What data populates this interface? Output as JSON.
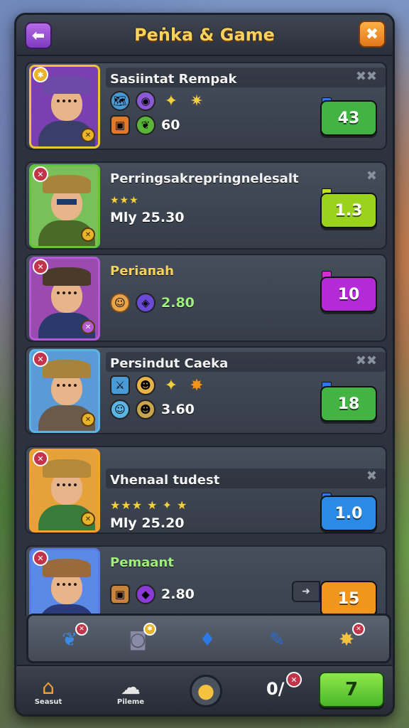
{
  "header": {
    "title": "Peṅka & Game",
    "back_icon": "back-arrow-icon",
    "close_icon": "star-close-icon"
  },
  "players": [
    {
      "name": "Sasiintat Rempak",
      "stat": "60",
      "score": "43",
      "score_color": "#43b344",
      "frame_color": "#f1c232",
      "bg": "#7a3fb0",
      "hat": "#6e4aa8",
      "body": "#3a3f6a"
    },
    {
      "name": "Perringsakrepringnelesalt",
      "stat": "Mly 25.30",
      "score": "1.3",
      "score_color": "#9ad21c",
      "frame_color": "#62c43a",
      "bg": "#7ac05a",
      "hat": "#a8843a",
      "body": "#4a6a2a"
    },
    {
      "name": "Periaпah",
      "stat": "2.80",
      "score": "10",
      "score_color": "#b42ad6",
      "frame_color": "#b45ad6",
      "bg": "#9a4ab0",
      "hat": "#4a3a2a",
      "body": "#2a3a6a"
    },
    {
      "name": "Persindut Caeka",
      "stat": "3.60",
      "score": "18",
      "score_color": "#43b344",
      "frame_color": "#5ab4e6",
      "bg": "#5a9ad6",
      "hat": "#a8843a",
      "body": "#6a5a4a"
    },
    {
      "name": "Vhenaal tudest",
      "stat": "Mly 25.20",
      "score": "1.0",
      "score_color": "#2a8ae6",
      "frame_color": "#f1a232",
      "bg": "#e6a23a",
      "hat": "#b48a3a",
      "body": "#3a7a3a"
    },
    {
      "name": "Pemaant",
      "stat": "2.80",
      "score": "15",
      "score_color": "#f1961c",
      "frame_color": "#5a7ae6",
      "bg": "#5a8ae6",
      "hat": "#9a6a3a",
      "body": "#2a3a7a"
    }
  ],
  "toolbar": {
    "items": [
      "potion-icon",
      "camera-icon",
      "gem-icon",
      "pencil-icon",
      "star-burst-icon"
    ]
  },
  "nav": {
    "home_label": "Seasut",
    "profile_label": "Pileme",
    "counter": "0/",
    "go_label": "7"
  },
  "colors": {
    "accent": "#f6d25a",
    "panel": "#2c333f"
  }
}
